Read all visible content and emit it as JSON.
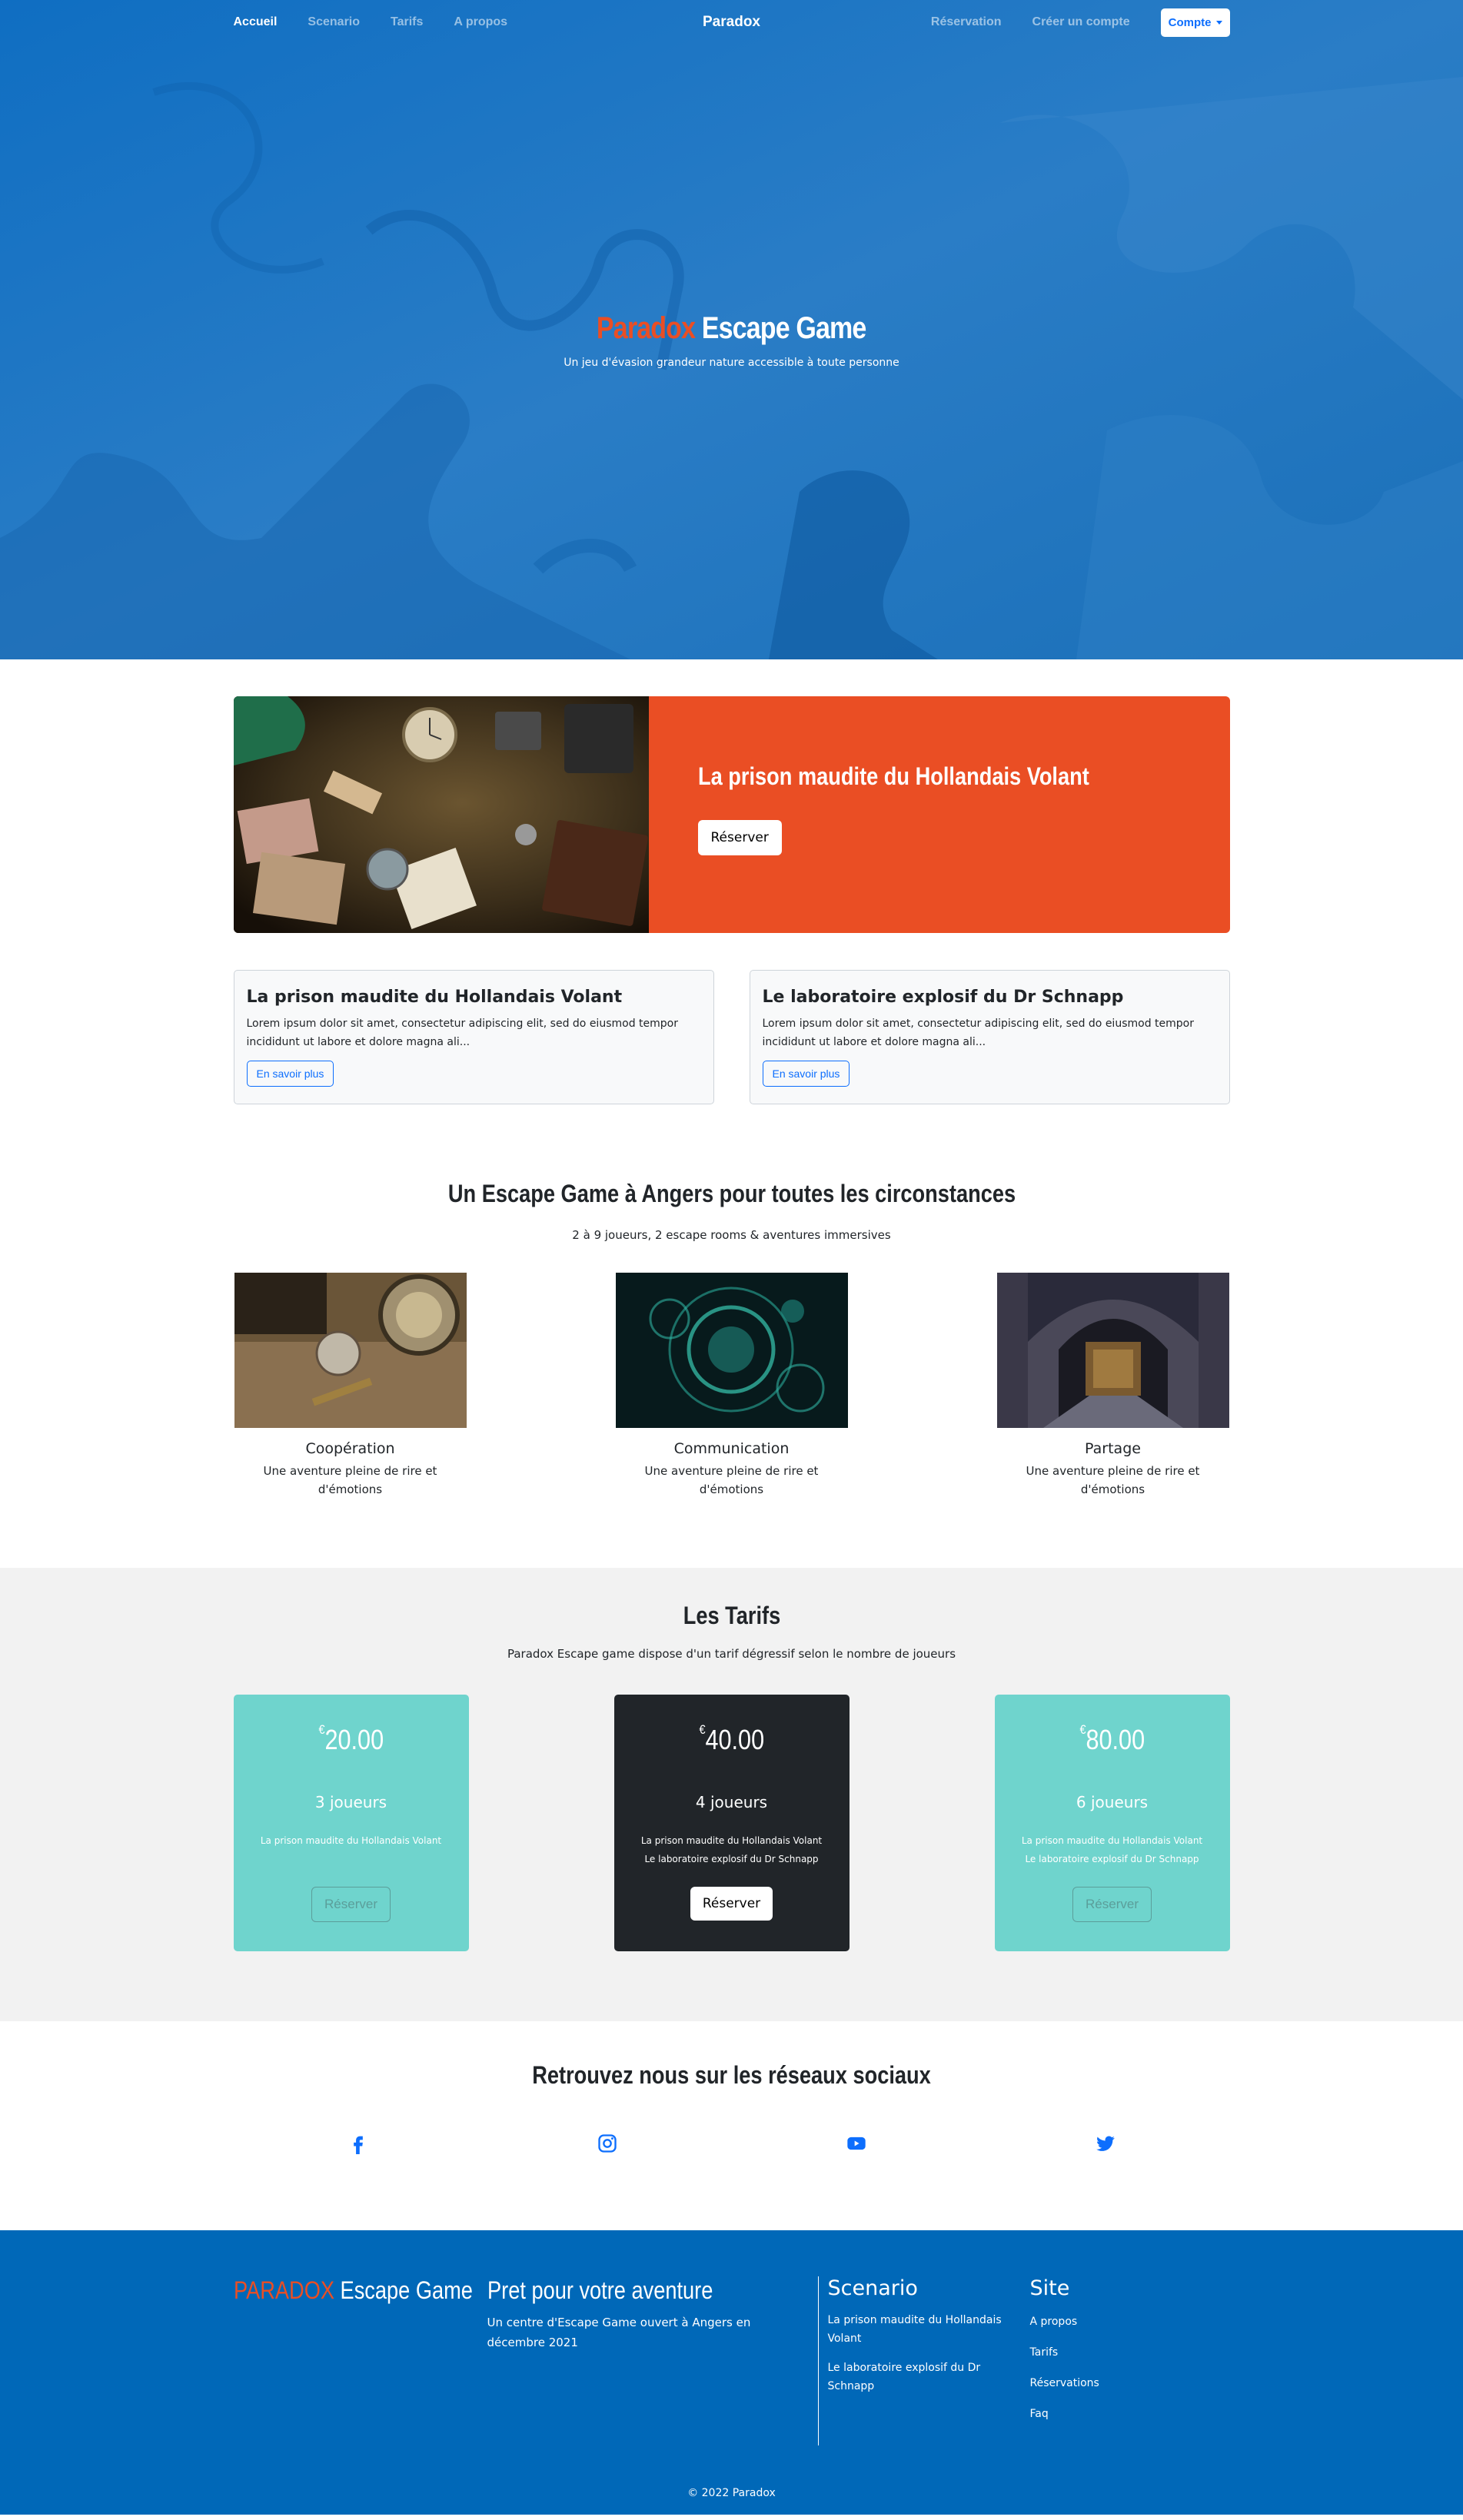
{
  "nav": {
    "links": [
      "Accueil",
      "Scenario",
      "Tarifs",
      "A propos"
    ],
    "brand": "Paradox",
    "right_links": [
      "Réservation",
      "Créer un compte"
    ],
    "account_label": "Compte"
  },
  "hero": {
    "title_accent": "Paradox",
    "title_rest": "Escape Game",
    "subtitle": "Un jeu d'évasion grandeur nature accessible à toute personne"
  },
  "featured": {
    "title": "La prison maudite du Hollandais Volant",
    "button": "Réserver"
  },
  "cards": [
    {
      "title": "La prison maudite du Hollandais Volant",
      "text": "Lorem ipsum dolor sit amet, consectetur adipiscing elit, sed do eiusmod tempor incididunt ut labore et dolore magna ali...",
      "button": "En savoir plus"
    },
    {
      "title": "Le laboratoire explosif du Dr Schnapp",
      "text": "Lorem ipsum dolor sit amet, consectetur adipiscing elit, sed do eiusmod tempor incididunt ut labore et dolore magna ali...",
      "button": "En savoir plus"
    }
  ],
  "circonstances": {
    "title": "Un Escape Game à Angers pour toutes les circonstances",
    "subtitle": "2 à 9 joueurs, 2 escape rooms & aventures immersives",
    "features": [
      {
        "name": "Coopération",
        "desc": "Une aventure pleine de rire et d'émotions"
      },
      {
        "name": "Communication",
        "desc": "Une aventure pleine de rire et d'émotions"
      },
      {
        "name": "Partage",
        "desc": "Une aventure pleine de rire et d'émotions"
      }
    ]
  },
  "tarifs": {
    "title": "Les Tarifs",
    "subtitle": "Paradox Escape game dispose d'un tarif dégressif selon le nombre de joueurs",
    "currency": "€",
    "plans": [
      {
        "price": "20.00",
        "players": "3 joueurs",
        "rooms": [
          "La prison maudite du Hollandais Volant"
        ],
        "button": "Réserver"
      },
      {
        "price": "40.00",
        "players": "4 joueurs",
        "rooms": [
          "La prison maudite du Hollandais Volant",
          "Le laboratoire explosif du Dr Schnapp"
        ],
        "button": "Réserver"
      },
      {
        "price": "80.00",
        "players": "6 joueurs",
        "rooms": [
          "La prison maudite du Hollandais Volant",
          "Le laboratoire explosif du Dr Schnapp"
        ],
        "button": "Réserver"
      }
    ]
  },
  "social": {
    "title": "Retrouvez nous sur les réseaux sociaux",
    "icons": [
      "facebook-icon",
      "instagram-icon",
      "youtube-icon",
      "twitter-icon"
    ],
    "color": "#0d6efd"
  },
  "footer": {
    "brand_accent": "PARADOX",
    "brand_rest": "Escape Game",
    "pret_title": "Pret pour votre aventure",
    "pret_text": "Un centre d'Escape Game ouvert à Angers en décembre 2021",
    "scenario_head": "Scenario",
    "scenario_links": [
      "La prison maudite du Hollandais Volant",
      "Le laboratoire explosif du Dr Schnapp"
    ],
    "site_head": "Site",
    "site_links": [
      "A propos",
      "Tarifs",
      "Réservations",
      "Faq"
    ],
    "copyright": "© 2022 Paradox"
  },
  "colors": {
    "hero_blue": "#1c74c4",
    "accent_orange": "#ea4e24",
    "teal": "#6fd4cd",
    "dark": "#212529",
    "footer_blue": "#0068b8",
    "link_blue": "#0d6efd"
  }
}
